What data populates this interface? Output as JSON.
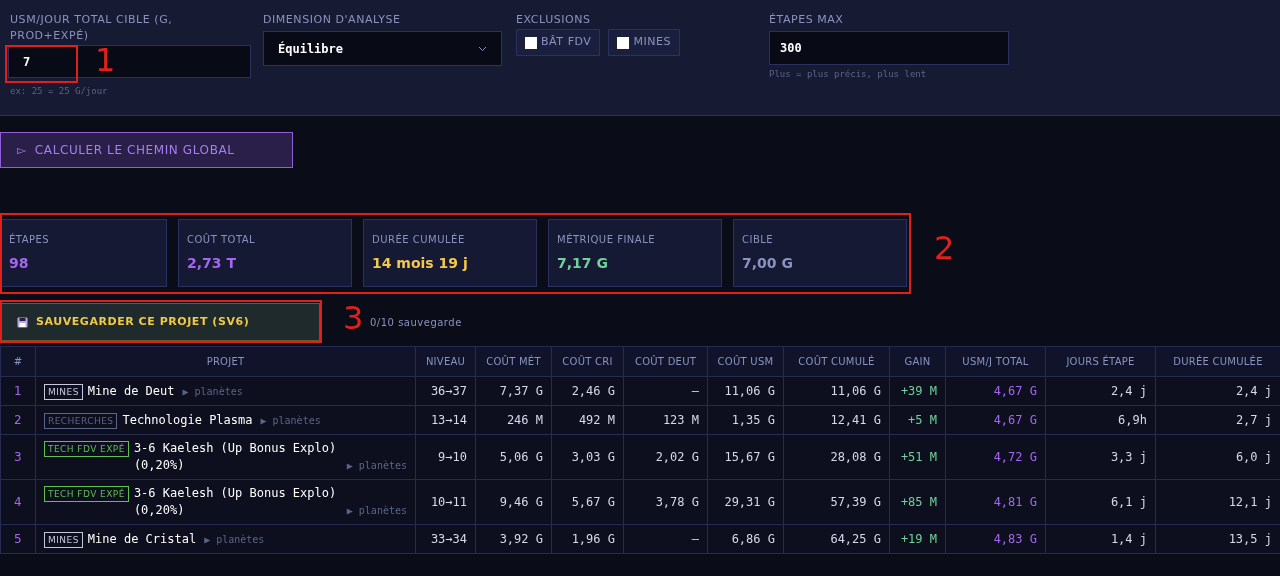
{
  "settings": {
    "target": {
      "label": "USM/JOUR TOTAL CIBLE (G, PROD+EXPÉ)",
      "value": "7",
      "hint": "ex: 25 = 25 G/jour"
    },
    "dimension": {
      "label": "DIMENSION D'ANALYSE",
      "value": "Équilibre"
    },
    "exclusions": {
      "label": "EXCLUSIONS",
      "options": [
        {
          "label": "BÂT FDV",
          "checked": false
        },
        {
          "label": "MINES",
          "checked": false
        }
      ]
    },
    "max_steps": {
      "label": "ÉTAPES MAX",
      "value": "300",
      "hint": "Plus = plus précis, plus lent"
    }
  },
  "calculate_button": {
    "icon": "▻",
    "label": "CALCULER LE CHEMIN GLOBAL"
  },
  "stats": [
    {
      "label": "ÉTAPES",
      "value": "98",
      "color": "#a466f0"
    },
    {
      "label": "COÛT TOTAL",
      "value": "2,73 T",
      "color": "#a466f0"
    },
    {
      "label": "DURÉE CUMULÉE",
      "value": "14 mois 19 j",
      "color": "#f5c84c"
    },
    {
      "label": "MÉTRIQUE FINALE",
      "value": "7,17 G",
      "color": "#6fd39a"
    },
    {
      "label": "CIBLE",
      "value": "7,00 G",
      "color": "#8a93c0"
    }
  ],
  "save": {
    "label": "SAUVEGARDER CE PROJET (SV6)",
    "count": "0/10 sauvegarde"
  },
  "table": {
    "columns": [
      "#",
      "PROJET",
      "NIVEAU",
      "COÛT MÉT",
      "COÛT CRI",
      "COÛT DEUT",
      "COÛT USM",
      "COÛT CUMULÉ",
      "GAIN",
      "USM/J TOTAL",
      "JOURS ÉTAPE",
      "DURÉE CUMULÉE"
    ],
    "rows": [
      {
        "num": "1",
        "tag": {
          "label": "MINES",
          "color": "#c4c8dc"
        },
        "name": "Mine de Deut",
        "planets": "▶ planètes",
        "level": "36→37",
        "met": "7,37 G",
        "cri": "2,46 G",
        "deut": "—",
        "usm": "11,06 G",
        "cumul": "11,06 G",
        "gain": "+39 M",
        "usmj": "4,67 G",
        "days": "2,4 j",
        "duration": "2,4 j"
      },
      {
        "num": "2",
        "tag": {
          "label": "RECHERCHES",
          "color": "#5c6388"
        },
        "name": "Technologie Plasma",
        "planets": "▶ planètes",
        "level": "13→14",
        "met": "246 M",
        "cri": "492 M",
        "deut": "123 M",
        "usm": "1,35 G",
        "cumul": "12,41 G",
        "gain": "+5 M",
        "usmj": "4,67 G",
        "days": "6,9h",
        "duration": "2,7 j"
      },
      {
        "num": "3",
        "tag": {
          "label": "TECH FDV EXPÉ",
          "color": "#5fbf4f"
        },
        "name": "3-6 Kaelesh (Up Bonus Explo) (0,20%)",
        "planets": "▶ planètes",
        "level": "9→10",
        "met": "5,06 G",
        "cri": "3,03 G",
        "deut": "2,02 G",
        "usm": "15,67 G",
        "cumul": "28,08 G",
        "gain": "+51 M",
        "usmj": "4,72 G",
        "days": "3,3 j",
        "duration": "6,0 j"
      },
      {
        "num": "4",
        "tag": {
          "label": "TECH FDV EXPÉ",
          "color": "#5fbf4f"
        },
        "name": "3-6 Kaelesh (Up Bonus Explo) (0,20%)",
        "planets": "▶ planètes",
        "level": "10→11",
        "met": "9,46 G",
        "cri": "5,67 G",
        "deut": "3,78 G",
        "usm": "29,31 G",
        "cumul": "57,39 G",
        "gain": "+85 M",
        "usmj": "4,81 G",
        "days": "6,1 j",
        "duration": "12,1 j"
      },
      {
        "num": "5",
        "tag": {
          "label": "MINES",
          "color": "#c4c8dc"
        },
        "name": "Mine de Cristal",
        "planets": "▶ planètes",
        "level": "33→34",
        "met": "3,92 G",
        "cri": "1,96 G",
        "deut": "—",
        "usm": "6,86 G",
        "cumul": "64,25 G",
        "gain": "+19 M",
        "usmj": "4,83 G",
        "days": "1,4 j",
        "duration": "13,5 j"
      }
    ]
  },
  "annotations": [
    {
      "label": "1"
    },
    {
      "label": "2"
    },
    {
      "label": "3"
    }
  ]
}
